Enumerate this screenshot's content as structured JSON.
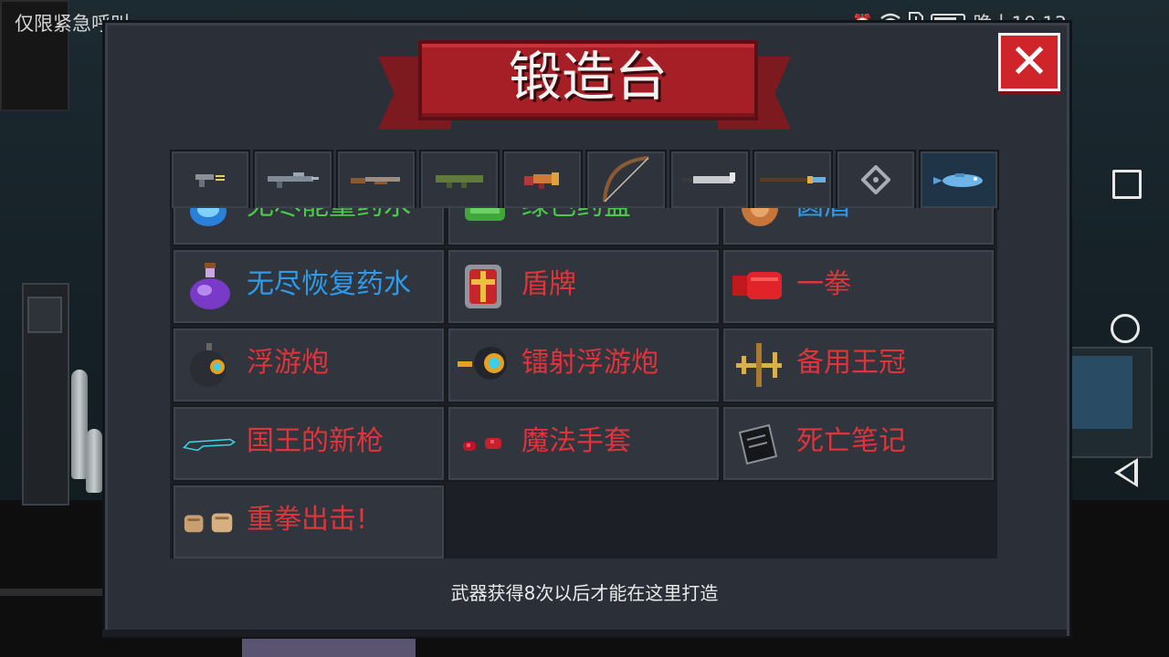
{
  "status_bar": {
    "left_text": "仅限紧急呼叫",
    "time": "晚上10:13"
  },
  "dialog": {
    "title": "锻造台",
    "close_label": "✕",
    "footer": "武器获得8次以后才能在这里打造"
  },
  "tabs": [
    {
      "icon": "pistol-icon",
      "active": false
    },
    {
      "icon": "rifle-icon",
      "active": false
    },
    {
      "icon": "shotgun-icon",
      "active": false
    },
    {
      "icon": "rocket-launcher-icon",
      "active": false
    },
    {
      "icon": "blaster-icon",
      "active": false
    },
    {
      "icon": "bow-icon",
      "active": false
    },
    {
      "icon": "sword-icon",
      "active": false
    },
    {
      "icon": "spear-icon",
      "active": false
    },
    {
      "icon": "shuriken-icon",
      "active": false
    },
    {
      "icon": "fish-icon",
      "active": true
    }
  ],
  "items": [
    {
      "label": "无尽能量药水",
      "color": "green",
      "icon": "blue-potion-icon"
    },
    {
      "label": "绿色药盒",
      "color": "green",
      "icon": "green-box-icon"
    },
    {
      "label": "圆盾",
      "color": "blue",
      "icon": "round-shield-icon"
    },
    {
      "label": "无尽恢复药水",
      "color": "blue",
      "icon": "purple-potion-icon"
    },
    {
      "label": "盾牌",
      "color": "red",
      "icon": "shield-icon"
    },
    {
      "label": "一拳",
      "color": "red",
      "icon": "red-fist-icon"
    },
    {
      "label": "浮游炮",
      "color": "red",
      "icon": "floating-cannon-icon"
    },
    {
      "label": "镭射浮游炮",
      "color": "red",
      "icon": "laser-cannon-icon"
    },
    {
      "label": "备用王冠",
      "color": "red",
      "icon": "crossbow-crown-icon"
    },
    {
      "label": "国王的新枪",
      "color": "red",
      "icon": "outline-gun-icon"
    },
    {
      "label": "魔法手套",
      "color": "red",
      "icon": "magic-gloves-icon"
    },
    {
      "label": "死亡笔记",
      "color": "red",
      "icon": "death-note-icon"
    },
    {
      "label": "重拳出击!",
      "color": "red",
      "icon": "fists-icon"
    }
  ]
}
